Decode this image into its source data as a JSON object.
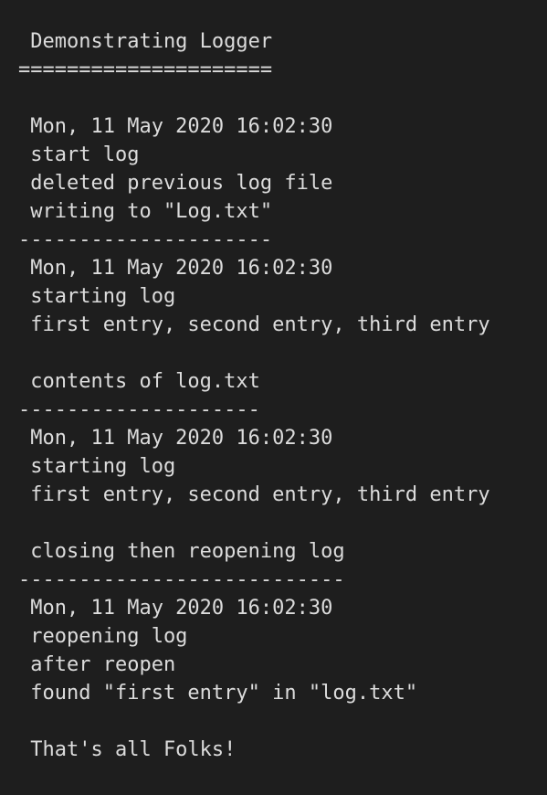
{
  "console": {
    "lines": [
      " Demonstrating Logger",
      "=====================",
      "",
      " Mon, 11 May 2020 16:02:30",
      " start log",
      " deleted previous log file",
      " writing to \"Log.txt\"",
      "---------------------",
      " Mon, 11 May 2020 16:02:30",
      " starting log",
      " first entry, second entry, third entry",
      "",
      " contents of log.txt",
      "--------------------",
      " Mon, 11 May 2020 16:02:30",
      " starting log",
      " first entry, second entry, third entry",
      "",
      " closing then reopening log",
      "---------------------------",
      " Mon, 11 May 2020 16:02:30",
      " reopening log",
      " after reopen",
      " found \"first entry\" in \"log.txt\"",
      "",
      " That's all Folks!"
    ]
  },
  "colors": {
    "background": "#1e1e1e",
    "text": "#dcdcdc"
  }
}
